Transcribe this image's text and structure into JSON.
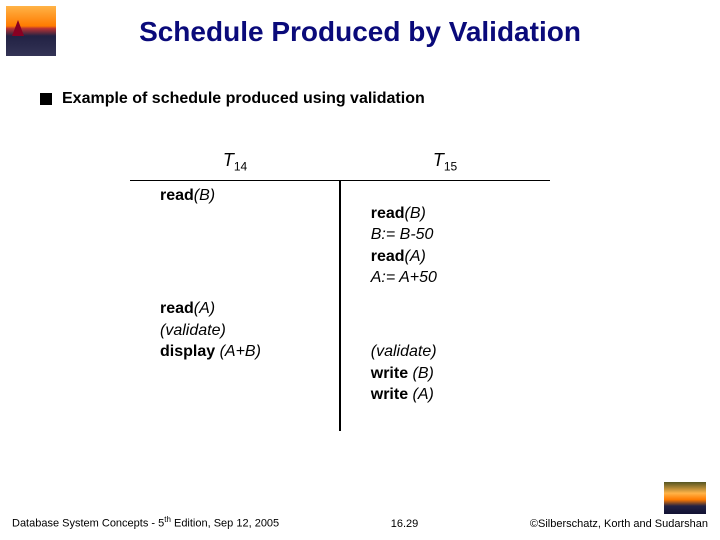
{
  "title": "Schedule Produced by Validation",
  "bullet": "Example of schedule produced using validation",
  "headers": {
    "t14": "T",
    "t14sub": "14",
    "t15": "T",
    "t15sub": "15"
  },
  "t14": {
    "l1a": "read",
    "l1b": "(B)",
    "l2a": "read",
    "l2b": "(A)",
    "l3a": "(validate)",
    "l4a": "display ",
    "l4b": "(A+B)"
  },
  "t15": {
    "l1a": "read",
    "l1b": "(B)",
    "l2": "B:= B-50",
    "l3a": "read",
    "l3b": "(A)",
    "l4": "A:= A+50",
    "l5": "(validate)",
    "l6a": "write ",
    "l6b": "(B)",
    "l7a": "write ",
    "l7b": "(A)"
  },
  "footer": {
    "leftA": "Database System Concepts - 5",
    "leftSup": "th",
    "leftB": " Edition, Sep 12, 2005",
    "center": "16.29",
    "right": "©Silberschatz, Korth and Sudarshan"
  }
}
